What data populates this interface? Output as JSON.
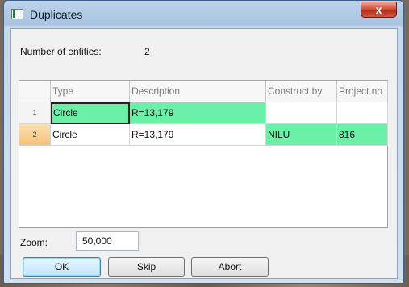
{
  "window": {
    "title": "Duplicates",
    "close_glyph": "x"
  },
  "summary": {
    "label": "Number of entities:",
    "value": "2"
  },
  "grid": {
    "columns": [
      "Type",
      "Description",
      "Construct by",
      "Project no"
    ],
    "rows": [
      {
        "index": "1",
        "type": "Circle",
        "description": "R=13,179",
        "construct_by": "",
        "project_no": ""
      },
      {
        "index": "2",
        "type": "Circle",
        "description": "R=13,179",
        "construct_by": "NILU",
        "project_no": "816"
      }
    ]
  },
  "zoom": {
    "label": "Zoom:",
    "value": "50,000"
  },
  "buttons": {
    "ok": "OK",
    "skip": "Skip",
    "abort": "Abort"
  },
  "colors": {
    "highlight": "#6bf0a8",
    "selected_row_header": "#f5c27a"
  }
}
